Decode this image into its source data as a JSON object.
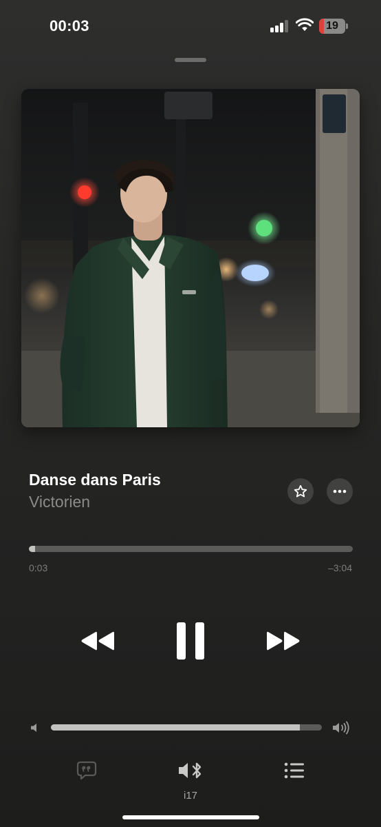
{
  "status_bar": {
    "time": "00:03",
    "battery_level": "19",
    "battery_fraction": 0.19
  },
  "track": {
    "title": "Danse dans Paris",
    "artist": "Victorien"
  },
  "playback": {
    "elapsed": "0:03",
    "remaining": "–3:04",
    "progress_fraction": 0.02,
    "state": "playing"
  },
  "volume": {
    "level_fraction": 0.92
  },
  "output": {
    "device_label": "i17"
  },
  "colors": {
    "accent_bg": "#2a2a29",
    "secondary_text": "#8b8b8a",
    "battery_low": "#e2403b"
  },
  "icons": {
    "favorite": "star-icon",
    "more": "ellipsis-icon",
    "rewind": "backward-icon",
    "pause": "pause-icon",
    "forward": "forward-icon",
    "lyrics": "lyrics-quote-icon",
    "airplay": "speaker-bluetooth-icon",
    "queue": "list-icon"
  }
}
